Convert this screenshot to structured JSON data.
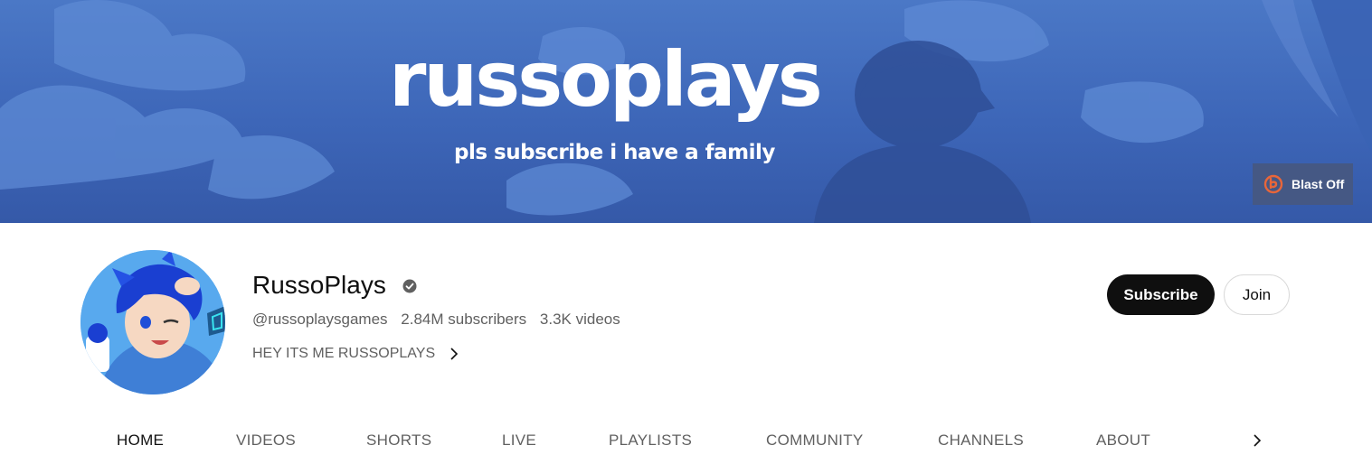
{
  "banner": {
    "title": "russoplays",
    "subtitle": "pls subscribe i have a family",
    "blast_off_label": "Blast Off",
    "colors": {
      "sky": "#4574c4",
      "accent": "#e8663a"
    }
  },
  "channel": {
    "name": "RussoPlays",
    "verified": true,
    "handle": "@russoplaysgames",
    "subscribers": "2.84M subscribers",
    "videos": "3.3K videos",
    "description": "HEY ITS ME RUSSOPLAYS"
  },
  "actions": {
    "subscribe_label": "Subscribe",
    "join_label": "Join"
  },
  "tabs": [
    {
      "label": "HOME",
      "active": true
    },
    {
      "label": "VIDEOS",
      "active": false
    },
    {
      "label": "SHORTS",
      "active": false
    },
    {
      "label": "LIVE",
      "active": false
    },
    {
      "label": "PLAYLISTS",
      "active": false
    },
    {
      "label": "COMMUNITY",
      "active": false
    },
    {
      "label": "CHANNELS",
      "active": false
    },
    {
      "label": "ABOUT",
      "active": false
    }
  ],
  "icons": {
    "verified": "verified-check-icon",
    "blast_off": "blast-off-icon",
    "description_more": "chevron-right-icon",
    "tabs_scroll": "chevron-right-icon"
  }
}
